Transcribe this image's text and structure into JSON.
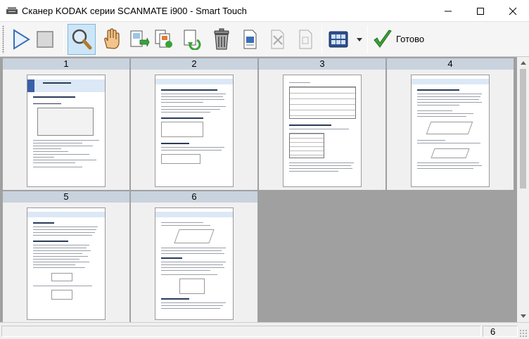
{
  "window": {
    "title": "Сканер KODAK серии SCANMATE i900 - Smart Touch"
  },
  "toolbar": {
    "buttons": [
      {
        "name": "start-scan-button",
        "icon": "play-icon"
      },
      {
        "name": "stop-scan-button",
        "icon": "stop-icon"
      },
      {
        "name": "zoom-button",
        "icon": "magnifier-icon",
        "active": true
      },
      {
        "name": "pan-button",
        "icon": "hand-icon"
      },
      {
        "name": "insert-page-button",
        "icon": "insert-page-icon"
      },
      {
        "name": "copy-pages-button",
        "icon": "copy-pages-icon"
      },
      {
        "name": "rotate-page-button",
        "icon": "rotate-page-icon"
      },
      {
        "name": "delete-page-button",
        "icon": "trash-icon"
      },
      {
        "name": "edit-page-button",
        "icon": "edit-page-icon"
      },
      {
        "name": "crop-page-button",
        "icon": "crop-page-icon"
      },
      {
        "name": "split-page-button",
        "icon": "split-page-icon"
      },
      {
        "name": "view-mode-button",
        "icon": "grid-view-icon"
      }
    ],
    "done_label": "Готово"
  },
  "pages": [
    {
      "number": "1"
    },
    {
      "number": "2"
    },
    {
      "number": "3"
    },
    {
      "number": "4"
    },
    {
      "number": "5"
    },
    {
      "number": "6"
    }
  ],
  "status": {
    "page_count": "6"
  },
  "colors": {
    "header": "#c8d3de",
    "workspace": "#a0a0a0",
    "selected_tool": "#cde6f7"
  }
}
